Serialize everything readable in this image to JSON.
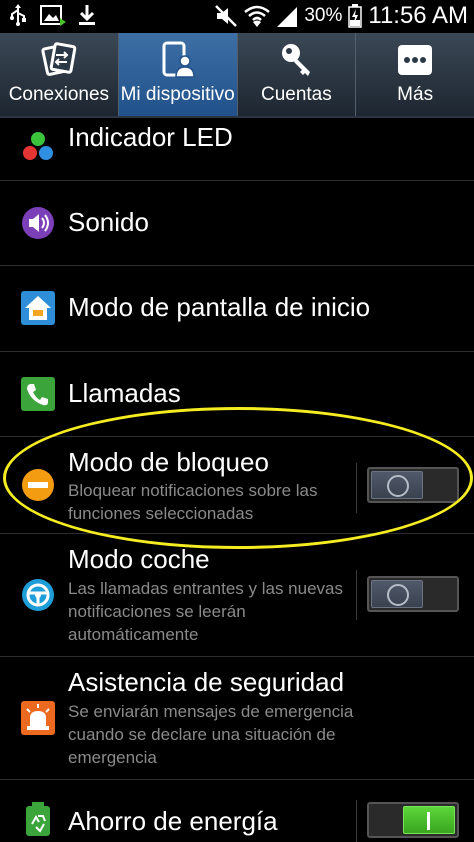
{
  "status_bar": {
    "battery": "30%",
    "time": "11:56 AM"
  },
  "tabs": [
    {
      "label": "Conexiones",
      "icon": "connections-icon",
      "active": false
    },
    {
      "label": "Mi dispositivo",
      "icon": "my-device-icon",
      "active": true
    },
    {
      "label": "Cuentas",
      "icon": "accounts-key-icon",
      "active": false
    },
    {
      "label": "Más",
      "icon": "more-icon",
      "active": false
    }
  ],
  "rows": {
    "indicador_led": {
      "title": "Indicador LED",
      "icon": "led-indicator-icon"
    },
    "sonido": {
      "title": "Sonido",
      "icon": "sound-icon"
    },
    "pantalla_inicio": {
      "title": "Modo de pantalla de inicio",
      "icon": "home-screen-icon"
    },
    "llamadas": {
      "title": "Llamadas",
      "icon": "phone-icon"
    },
    "bloqueo": {
      "title": "Modo de bloqueo",
      "subtitle": "Bloquear notificaciones sobre las funciones seleccionadas",
      "icon": "block-icon",
      "toggle_on": false
    },
    "coche": {
      "title": "Modo coche",
      "subtitle": "Las llamadas entrantes y las nuevas notificaciones se leerán automáticamente",
      "icon": "steering-wheel-icon",
      "toggle_on": false
    },
    "seguridad": {
      "title": "Asistencia de seguridad",
      "subtitle": "Se enviarán mensajes de emergencia cuando se declare una situación de emergencia",
      "icon": "emergency-siren-icon"
    },
    "energia": {
      "title": "Ahorro de energía",
      "icon": "battery-recycle-icon",
      "toggle_on": true
    }
  },
  "colors": {
    "highlight_ellipse": "#f5ec21",
    "toggle_on": "#4cc22c",
    "active_tab": "#2c5f99"
  }
}
